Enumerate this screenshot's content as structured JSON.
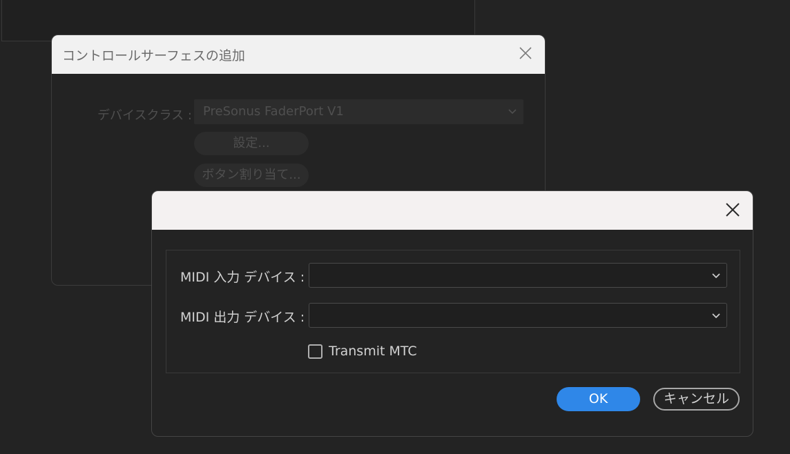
{
  "back_dialog": {
    "title": "コントロールサーフェスの追加",
    "device_class_label": "デバイスクラス :",
    "device_class_value": "PreSonus FaderPort V1",
    "settings_button": "設定...",
    "button_assign_button": "ボタン割り当て..."
  },
  "front_dialog": {
    "midi_input_label": "MIDI 入力 デバイス :",
    "midi_input_value": "",
    "midi_output_label": "MIDI 出力 デバイス :",
    "midi_output_value": "",
    "transmit_mtc_label": "Transmit MTC",
    "transmit_mtc_checked": false,
    "ok_button": "OK",
    "cancel_button": "キャンセル"
  },
  "icons": {
    "close": "close-icon",
    "dropdown": "chevron-down-icon"
  },
  "colors": {
    "accent": "#2f87e8",
    "background": "#232323",
    "titlebar": "#f4f1f1"
  }
}
